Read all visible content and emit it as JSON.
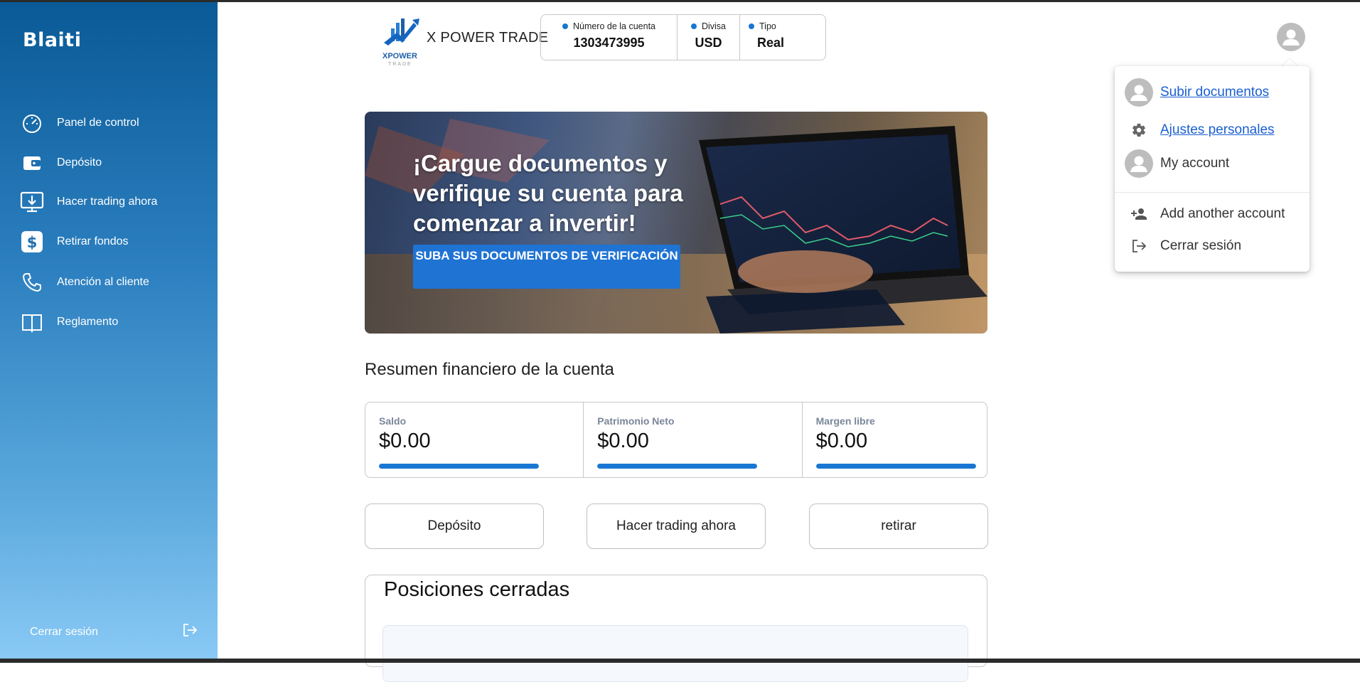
{
  "sidebar": {
    "brand": "Blaiti",
    "items": [
      {
        "label": "Panel de control",
        "icon": "speedometer-icon"
      },
      {
        "label": "Depósito",
        "icon": "wallet-icon"
      },
      {
        "label": "Hacer trading ahora",
        "icon": "monitor-download-icon"
      },
      {
        "label": "Retirar fondos",
        "icon": "dollar-icon"
      },
      {
        "label": "Atención al cliente",
        "icon": "phone-icon"
      },
      {
        "label": "Reglamento",
        "icon": "book-icon"
      }
    ],
    "logout_label": "Cerrar sesión",
    "logout_icon": "logout-icon"
  },
  "header": {
    "logo_text": "X POWER TRADE",
    "logo_subtext": "XPOWER",
    "logo_small": "TRADE",
    "account_number_label": "Número de la cuenta",
    "account_number": "1303473995",
    "currency_label": "Divisa",
    "currency": "USD",
    "type_label": "Tipo",
    "type": "Real",
    "accent_color": "#1976d2"
  },
  "menu": {
    "upload_docs": "Subir documentos",
    "personal_settings": "Ajustes personales",
    "my_account": "My account",
    "add_account": "Add another account",
    "logout": "Cerrar sesión"
  },
  "banner": {
    "title": "¡Cargue documentos y verifique su cuenta para comenzar a invertir!",
    "button": "SUBA SUS DOCUMENTOS DE VERIFICACIÓN"
  },
  "summary": {
    "title": "Resumen financiero de la cuenta",
    "cards": [
      {
        "label": "Saldo",
        "value": "$0.00",
        "fill": 1.0
      },
      {
        "label": "Patrimonio Neto",
        "value": "$0.00",
        "fill": 1.0
      },
      {
        "label": "Margen libre",
        "value": "$0.00",
        "fill": 1.0
      }
    ]
  },
  "actions": {
    "deposit": "Depósito",
    "trade": "Hacer trading ahora",
    "withdraw": "retirar"
  },
  "closed_positions": {
    "title": "Posiciones cerradas"
  }
}
